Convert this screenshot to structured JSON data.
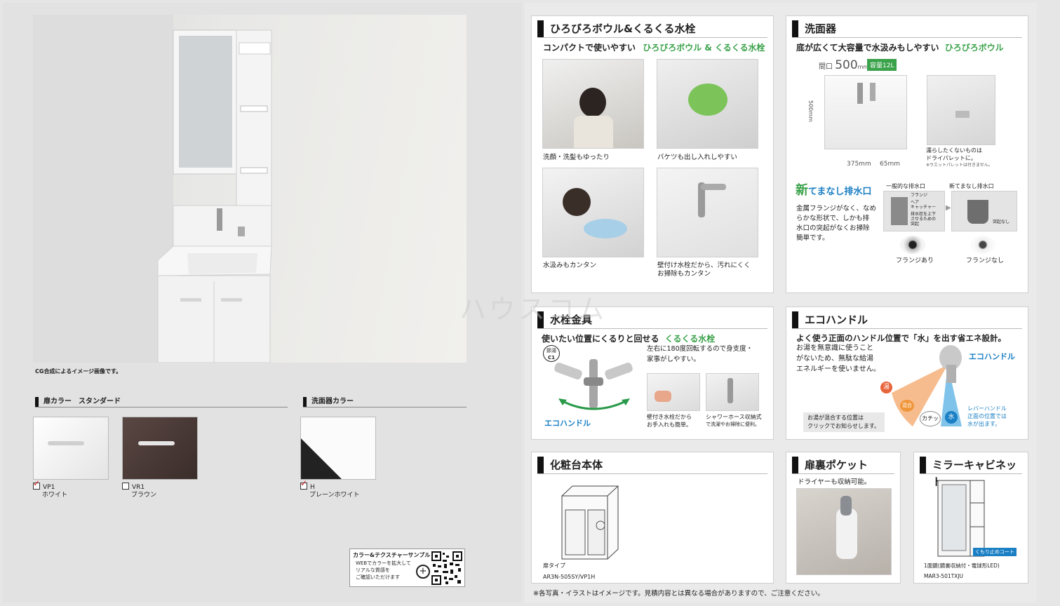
{
  "left": {
    "image_caption": "CG合成によるイメージ画像です。",
    "door_color_header": "扉カラー　スタンダード",
    "basin_color_header": "洗面器カラー",
    "swatches": [
      {
        "code": "VP1",
        "name": "ホワイト",
        "checked": true,
        "color": "#f4f4f4"
      },
      {
        "code": "VR1",
        "name": "ブラウン",
        "checked": false,
        "color": "#4a3a36"
      },
      {
        "code": "H",
        "name": "プレーンホワイト",
        "checked": true,
        "color": "#fafafa"
      }
    ],
    "qr_title": "カラー&テクスチャーサンプル",
    "qr_text": [
      "WEBでカラーを拡大して",
      "リアルな質感を",
      "ご確認いただけます"
    ]
  },
  "bowl": {
    "title": "ひろびろボウル&くるくる水栓",
    "sub_plain": "コンパクトで使いやすい",
    "sub_green": "ひろびろボウル & くるくる水栓",
    "captions": [
      "洗顔・洗髪もゆったり",
      "バケツも出し入れしやすい",
      "水汲みもカンタン",
      "壁付け水栓だから、汚れにくく",
      "お掃除もカンタン"
    ]
  },
  "basin": {
    "title": "洗面器",
    "sub_plain": "底が広くて大容量で水汲みもしやすい",
    "sub_green": "ひろびろボウル",
    "opening_label": "間口",
    "opening_value": "500",
    "opening_unit": "mm",
    "capacity_badge": "容量12L",
    "dim_height": "500mm",
    "dim_width": "375mm",
    "dim_side": "65mm",
    "pallet_note": [
      "濡らしたくないものは",
      "ドライパレットに。"
    ],
    "pallet_small": "※ウエットパレットは付きません。",
    "drain_new": "新",
    "drain_name": "てまなし排水口",
    "drain_desc": [
      "金属フランジがなく、なめ",
      "らかな形状で、しかも排",
      "水口の突起がなくお掃除",
      "簡単です。"
    ],
    "drain_general": "一般的な排水口",
    "drain_new_label": "新てまなし排水口",
    "drain_parts": [
      "フランジ",
      "ヘア",
      "キャッチャー",
      "排水栓を上下",
      "させるための",
      "突起",
      "突起なし"
    ],
    "flange_yes": "フランジあり",
    "flange_no": "フランジなし"
  },
  "faucet": {
    "title": "水栓金具",
    "sub_plain": "使いたい位置にくるりと回せる",
    "sub_green": "くるくる水栓",
    "badge": [
      "節湯",
      "C1"
    ],
    "desc": [
      "左右に180度回転するので身支度・",
      "家事がしやすい。"
    ],
    "eco_brand": "エコハンドル",
    "cap1": [
      "壁付き水栓だから",
      "お手入れも簡単。"
    ],
    "cap2": [
      "シャワーホース収納式",
      "で洗濯やお掃除に便利。"
    ]
  },
  "eco": {
    "title": "エコハンドル",
    "sub": "よく使う正面のハンドル位置で「水」を出す省エネ設計。",
    "desc": [
      "お湯を無意識に使うこと",
      "がないため、無駄な給湯",
      "エネルギーを使いません。"
    ],
    "brand": "エコハンドル",
    "hot": "湯",
    "mix": "混合",
    "click": "カチッ",
    "water": "水",
    "note": [
      "お湯が混合する位置は",
      "クリックでお知らせします。"
    ],
    "lever": [
      "レバーハンドル",
      "正面の位置では",
      "水が出ます。"
    ]
  },
  "body": {
    "title": "化粧台本体",
    "type_label": "扉タイプ",
    "model": "AR3N-505SY/VP1H"
  },
  "pocket": {
    "title": "扉裏ポケット",
    "sub": "ドライヤーも収納可能。"
  },
  "mirror": {
    "title": "ミラーキャビネット",
    "badge": "くもり止めコート",
    "desc": "1面鏡(鏡裏収納付・電球形LED)",
    "model": "MAR3-501TXJU"
  },
  "footnote": "※各写真・イラストはイメージです。見積内容とは異なる場合がありますので、ご注意ください。",
  "watermark": "ハウスコム"
}
